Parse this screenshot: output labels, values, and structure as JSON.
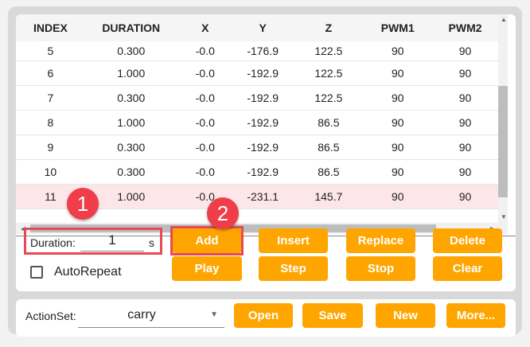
{
  "table": {
    "columns": [
      "INDEX",
      "DURATION",
      "X",
      "Y",
      "Z",
      "PWM1",
      "PWM2"
    ],
    "rows": [
      [
        "5",
        "0.300",
        "-0.0",
        "-176.9",
        "122.5",
        "90",
        "90"
      ],
      [
        "6",
        "1.000",
        "-0.0",
        "-192.9",
        "122.5",
        "90",
        "90"
      ],
      [
        "7",
        "0.300",
        "-0.0",
        "-192.9",
        "122.5",
        "90",
        "90"
      ],
      [
        "8",
        "1.000",
        "-0.0",
        "-192.9",
        "86.5",
        "90",
        "90"
      ],
      [
        "9",
        "0.300",
        "-0.0",
        "-192.9",
        "86.5",
        "90",
        "90"
      ],
      [
        "10",
        "0.300",
        "-0.0",
        "-192.9",
        "86.5",
        "90",
        "90"
      ],
      [
        "11",
        "1.000",
        "-0.0",
        "-231.1",
        "145.7",
        "90",
        "90"
      ]
    ],
    "selected_index": "11"
  },
  "controls": {
    "duration_label": "Duration:",
    "duration_value": "1",
    "duration_unit": "s",
    "autorepeat_label": "AutoRepeat",
    "autorepeat_checked": false,
    "buttons": {
      "add": "Add",
      "insert": "Insert",
      "replace": "Replace",
      "delete": "Delete",
      "play": "Play",
      "step": "Step",
      "stop": "Stop",
      "clear": "Clear"
    }
  },
  "actionset": {
    "label": "ActionSet:",
    "value": "carry",
    "buttons": {
      "open": "Open",
      "save": "Save",
      "new": "New",
      "more": "More..."
    }
  },
  "annotations": {
    "badge1": "1",
    "badge2": "2"
  },
  "colors": {
    "accent": "#ffa500",
    "highlight": "#e84855",
    "selected_row": "#fde6ea"
  }
}
